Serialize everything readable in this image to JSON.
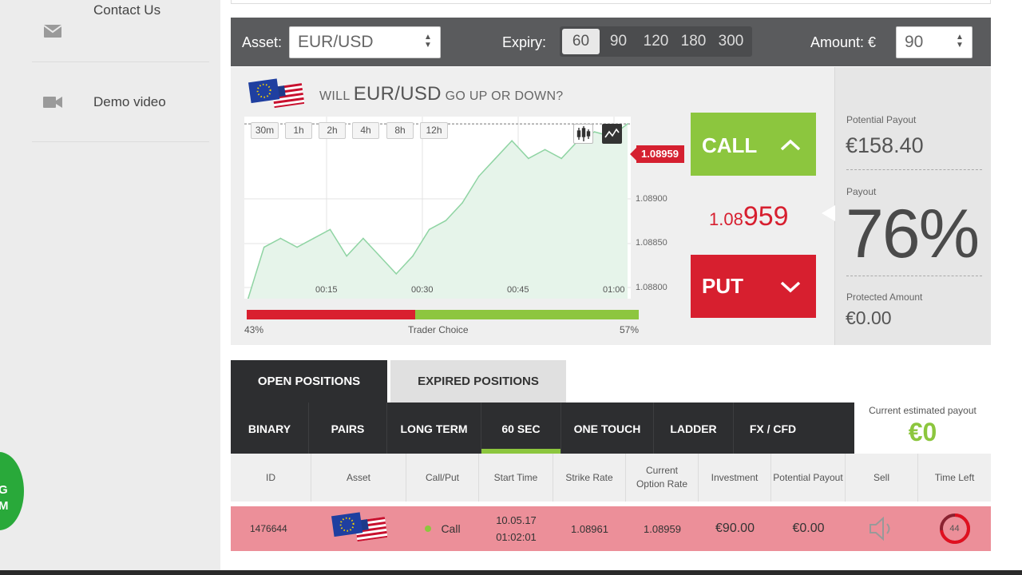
{
  "sidebar": {
    "items": [
      {
        "label": "Contact Us",
        "icon": "envelope-icon"
      },
      {
        "label": "Demo video",
        "icon": "video-camera-icon"
      }
    ],
    "badge_text_1": "G",
    "badge_text_2": "M"
  },
  "trade_bar": {
    "asset_label": "Asset:",
    "asset_value": "EUR/USD",
    "expiry_label": "Expiry:",
    "expiry_options": [
      "60",
      "90",
      "120",
      "180",
      "300"
    ],
    "expiry_selected": "60",
    "amount_label": "Amount: €",
    "amount_value": "90"
  },
  "question": {
    "prefix": "WILL",
    "asset": "EUR/USD",
    "suffix": "GO UP OR DOWN?"
  },
  "chart": {
    "timeframes": [
      "30m",
      "1h",
      "2h",
      "4h",
      "8h",
      "12h"
    ],
    "current_price_tag": "1.08959",
    "y_ticks": [
      "1.08900",
      "1.08850",
      "1.08800"
    ],
    "x_ticks": [
      "00:15",
      "00:30",
      "00:45",
      "01:00"
    ]
  },
  "chart_data": {
    "type": "area",
    "x": [
      "00:05",
      "00:07",
      "00:10",
      "00:12",
      "00:15",
      "00:17",
      "00:20",
      "00:22",
      "00:25",
      "00:27",
      "00:30",
      "00:32",
      "00:35",
      "00:37",
      "00:40",
      "00:42",
      "00:45",
      "00:47",
      "00:50",
      "00:52",
      "00:55",
      "00:57",
      "01:00",
      "01:02"
    ],
    "y": [
      1.0876,
      1.0882,
      1.0883,
      1.0882,
      1.0883,
      1.0884,
      1.0881,
      1.0883,
      1.0881,
      1.0879,
      1.0881,
      1.0884,
      1.0885,
      1.0887,
      1.089,
      1.0892,
      1.0894,
      1.0892,
      1.0893,
      1.0892,
      1.0894,
      1.0895,
      1.08945,
      1.08959
    ],
    "ylim": [
      1.0878,
      1.0896
    ],
    "grid": true
  },
  "trader_choice": {
    "put_pct": "43%",
    "call_pct": "57%",
    "put_value": 43,
    "call_value": 57,
    "label": "Trader Choice"
  },
  "actions": {
    "call_label": "CALL",
    "put_label": "PUT",
    "price_small": "1.08",
    "price_big": "959"
  },
  "payout_panel": {
    "potential_label": "Potential Payout",
    "potential_value": "€158.40",
    "payout_label": "Payout",
    "payout_value": "76%",
    "protected_label": "Protected Amount",
    "protected_value": "€0.00"
  },
  "positions": {
    "tab_open": "OPEN POSITIONS",
    "tab_expired": "EXPIRED POSITIONS",
    "subtabs": [
      "BINARY",
      "PAIRS",
      "LONG TERM",
      "60 SEC",
      "ONE TOUCH",
      "LADDER",
      "FX / CFD"
    ],
    "active_subtab": "60 SEC",
    "estimated_label": "Current estimated payout",
    "estimated_value": "€0",
    "columns": [
      "ID",
      "Asset",
      "Call/Put",
      "Start Time",
      "Strike Rate",
      "Current Option Rate",
      "Investment",
      "Potential Payout",
      "Sell",
      "Time Left"
    ],
    "rows": [
      {
        "id": "1476644",
        "direction": "Call",
        "start_date": "10.05.17",
        "start_time": "01:02:01",
        "strike": "1.08961",
        "current": "1.08959",
        "investment": "€90.00",
        "potential": "€0.00",
        "time_left": "44",
        "time_left_fraction": 0.73
      }
    ]
  },
  "colors": {
    "call_green": "#8cc63e",
    "put_red": "#d71f2f",
    "dark_bar": "#2d2e30",
    "row_highlight": "#ec8f99"
  }
}
